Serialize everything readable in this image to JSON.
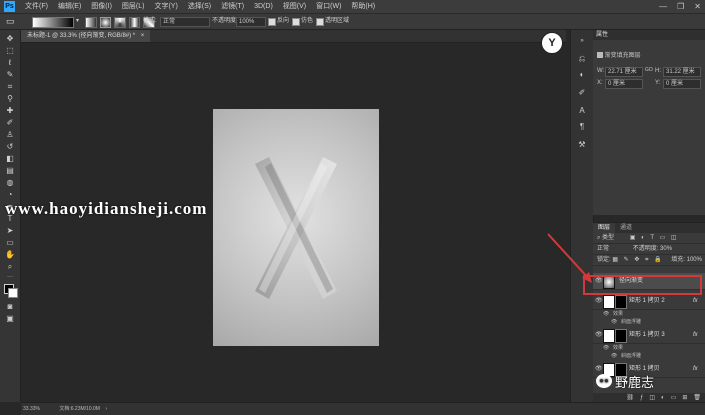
{
  "app": {
    "logo": "Ps"
  },
  "menu": [
    "文件(F)",
    "编辑(E)",
    "图像(I)",
    "图层(L)",
    "文字(Y)",
    "选择(S)",
    "滤镜(T)",
    "3D(D)",
    "视图(V)",
    "窗口(W)",
    "帮助(H)"
  ],
  "window_controls": {
    "minimize": "—",
    "restore": "❐",
    "close": "✕"
  },
  "options_bar": {
    "mode_label": "模式:",
    "mode_value": "正常",
    "opacity_label": "不透明度:",
    "opacity_value": "100%",
    "reverse_label": "反向",
    "dither_label": "仿色",
    "transparency_label": "透明区域"
  },
  "document_tab": {
    "title": "未标题-1 @ 33.3% (径向渐变, RGB/8#) *",
    "close": "×"
  },
  "watermark": "www.haoyidiansheji.com",
  "badge_glyph": "Y",
  "properties_panel": {
    "title": "属性",
    "subtitle": "渐变填充图层",
    "w_label": "W:",
    "w_value": "22.71 厘米",
    "link_glyph": "GO",
    "h_label": "H:",
    "h_value": "31.22 厘米",
    "x_label": "X:",
    "x_value": "0 厘米",
    "y_label": "Y:",
    "y_value": "0 厘米"
  },
  "layers_panel": {
    "tabs": [
      "图层",
      "通道"
    ],
    "kind_label": "类型",
    "blend_label": "正常",
    "opacity_label": "不透明度:",
    "opacity_value": "30%",
    "lock_label": "锁定:",
    "fill_label": "填充:",
    "fill_value": "100%",
    "layers": [
      {
        "name": "径向渐变"
      },
      {
        "name": "矩形 1 拷贝 2",
        "effects_label": "效果",
        "effect": "斜面浮雕"
      },
      {
        "name": "矩形 1 拷贝 3",
        "effects_label": "效果",
        "effect": "斜面浮雕"
      },
      {
        "name": "矩形 1 拷贝"
      }
    ],
    "fx_label": "fx"
  },
  "wechat_label": "野鹿志",
  "status": {
    "zoom": "33.33%",
    "doc": "文档:6.23M/10.0M"
  },
  "colors": {
    "highlight": "#d23a3a",
    "accent": "#31a8ff"
  }
}
